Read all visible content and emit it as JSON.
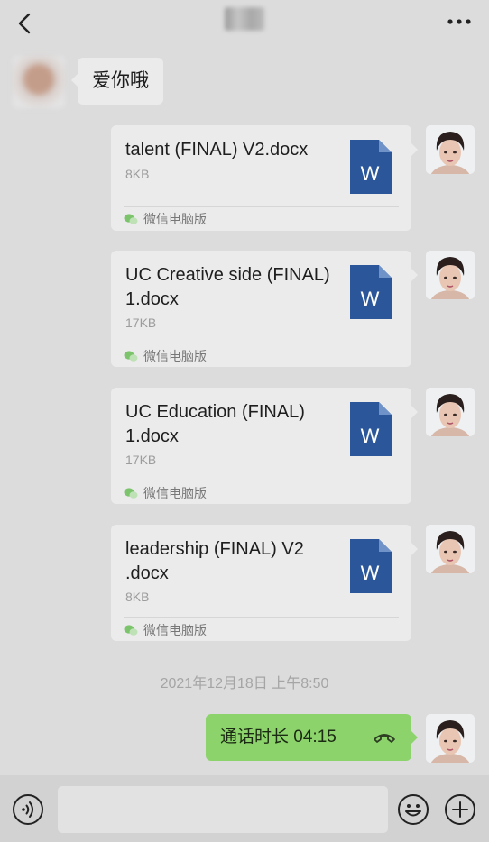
{
  "header": {
    "back_icon": "chevron-left-icon",
    "more_icon": "more-dots-icon"
  },
  "messages": {
    "incoming_text": "爱你哦",
    "files": [
      {
        "name": "talent (FINAL) V2.docx",
        "size": "8KB",
        "source": "微信电脑版",
        "icon": "word-doc-icon",
        "icon_letter": "W"
      },
      {
        "name": "UC Creative side (FINAL) 1.docx",
        "size": "17KB",
        "source": "微信电脑版",
        "icon": "word-doc-icon",
        "icon_letter": "W"
      },
      {
        "name": "UC Education (FINAL) 1.docx",
        "size": "17KB",
        "source": "微信电脑版",
        "icon": "word-doc-icon",
        "icon_letter": "W"
      },
      {
        "name": "leadership (FINAL) V2 .docx",
        "size": "8KB",
        "source": "微信电脑版",
        "icon": "word-doc-icon",
        "icon_letter": "W"
      }
    ],
    "timestamp": "2021年12月18日 上午8:50",
    "call": {
      "label": "通话时长 04:15",
      "icon": "phone-hangup-icon"
    }
  },
  "input_bar": {
    "voice_icon": "voice-icon",
    "emoji_icon": "emoji-icon",
    "plus_icon": "plus-icon"
  },
  "colors": {
    "background": "#dcdcdc",
    "bubble": "#ebebeb",
    "call_bubble": "#8cd36c",
    "word_blue": "#2b579a"
  }
}
